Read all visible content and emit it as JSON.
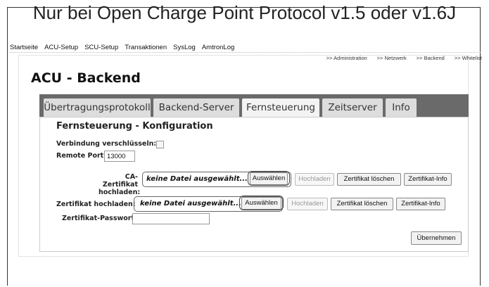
{
  "doc": {
    "title": "Nur bei Open Charge Point Protocol v1.5 oder v1.6J"
  },
  "nav": {
    "items": [
      "Startseite",
      "ACU-Setup",
      "SCU-Setup",
      "Transaktionen",
      "SysLog",
      "AmtronLog"
    ]
  },
  "sub_nav": {
    "items": [
      ">> Administration",
      ">> Netzwerk",
      ">> Backend",
      ">> Whitelist"
    ]
  },
  "page": {
    "heading": "ACU - Backend"
  },
  "tabs": [
    {
      "label": "Übertragungsprotokoll",
      "active": false
    },
    {
      "label": "Backend-Server",
      "active": false
    },
    {
      "label": "Fernsteuerung",
      "active": true
    },
    {
      "label": "Zeitserver",
      "active": false
    },
    {
      "label": "Info",
      "active": false
    }
  ],
  "section": {
    "title": "Fernsteuerung - Konfiguration"
  },
  "form": {
    "encrypt_label": "Verbindung verschlüsseln:",
    "encrypt_checked": false,
    "port_label": "Remote Port:",
    "port_value": "13000",
    "ca_label_1": "CA-Zertifikat",
    "ca_label_2": "hochladen:",
    "ca_file": "keine Datei ausgewählt...",
    "cert_label": "Zertifikat hochladen:",
    "cert_file": "keine Datei ausgewählt...",
    "password_label": "Zertifikat-Passwort:",
    "password_value": ""
  },
  "buttons": {
    "choose": "Auswählen",
    "upload": "Hochladen",
    "delete_cert": "Zertifikat löschen",
    "cert_info": "Zertifikat-Info",
    "apply": "Übernehmen"
  }
}
